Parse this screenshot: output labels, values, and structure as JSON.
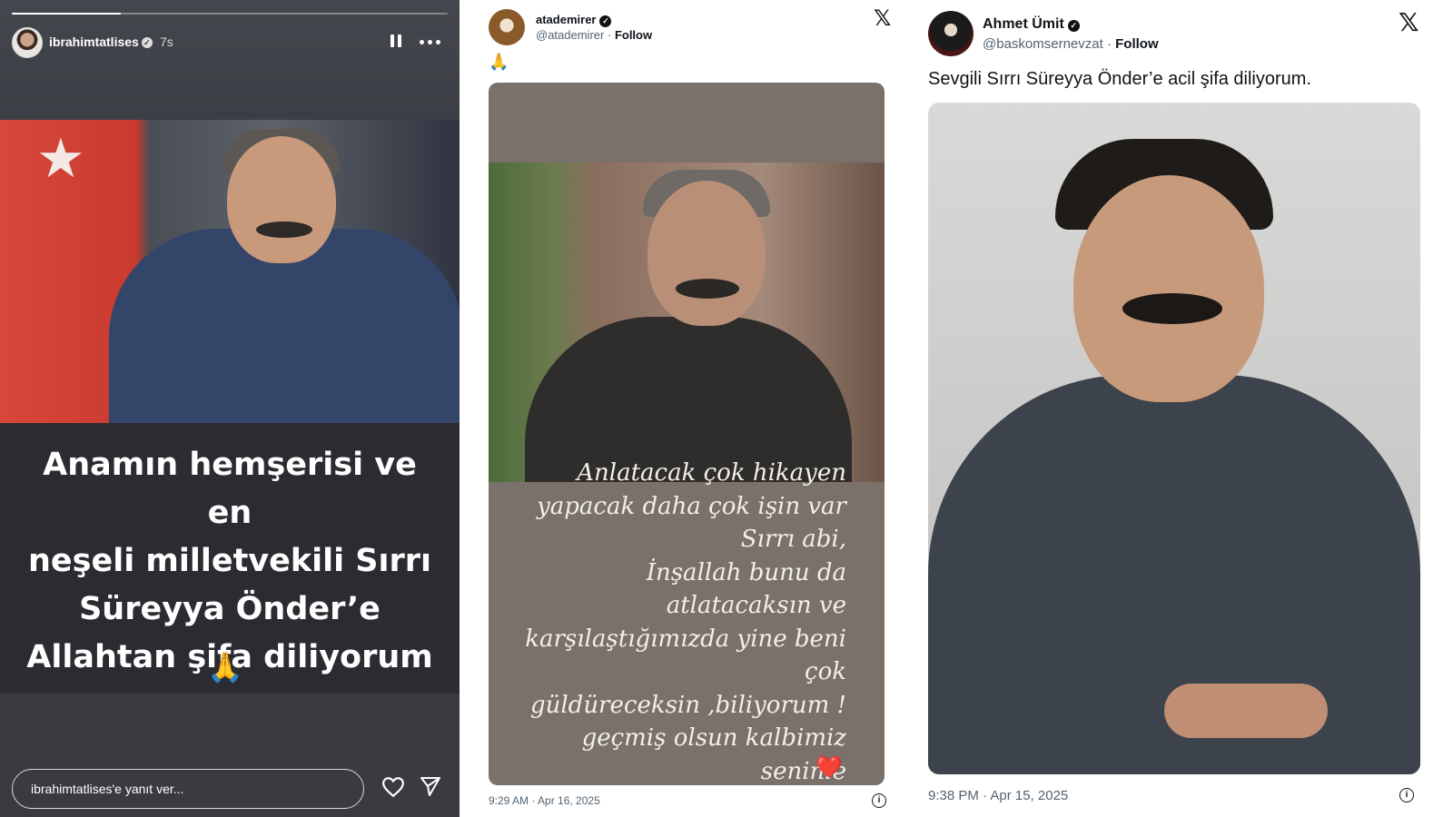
{
  "story": {
    "username": "ibrahimtatlises",
    "time": "7s",
    "progress": 0.25,
    "caption": "Anamın hemşerisi ve en\nneşeli milletvekili Sırrı\nSüreyya Önder’e\nAllahtan şifa diliyorum",
    "emoji": "🙏",
    "reply_placeholder": "ibrahimtatlises'e yanıt ver..."
  },
  "tweet1": {
    "name": "atademirer",
    "handle": "@atademirer",
    "follow": "Follow",
    "separator": "·",
    "text": "🙏",
    "image_text": "Anlatacak çok hikayen\nyapacak daha çok işin var\nSırrı abi,\nİnşallah bunu da\natlatacaksın ve\nkarşılaştığımızda yine beni\nçok\ngüldüreceksin ,biliyorum !\ngeçmiş olsun kalbimiz seninle",
    "image_emoji": "❤️",
    "timestamp": "9:29 AM · Apr 16, 2025"
  },
  "tweet2": {
    "name": "Ahmet Ümit",
    "handle": "@baskomsernevzat",
    "follow": "Follow",
    "separator": "·",
    "text": "Sevgili Sırrı Süreyya Önder’e acil şifa diliyorum.",
    "timestamp": "9:38 PM · Apr 15, 2025"
  },
  "icons": {
    "x_logo": "𝕏",
    "verified": "✓",
    "info": "i"
  },
  "colors": {
    "story_bg": "#3a3b40",
    "story_text_bg": "#2b2c31",
    "tweet_text": "#0f1419",
    "tweet_secondary": "#536471"
  }
}
